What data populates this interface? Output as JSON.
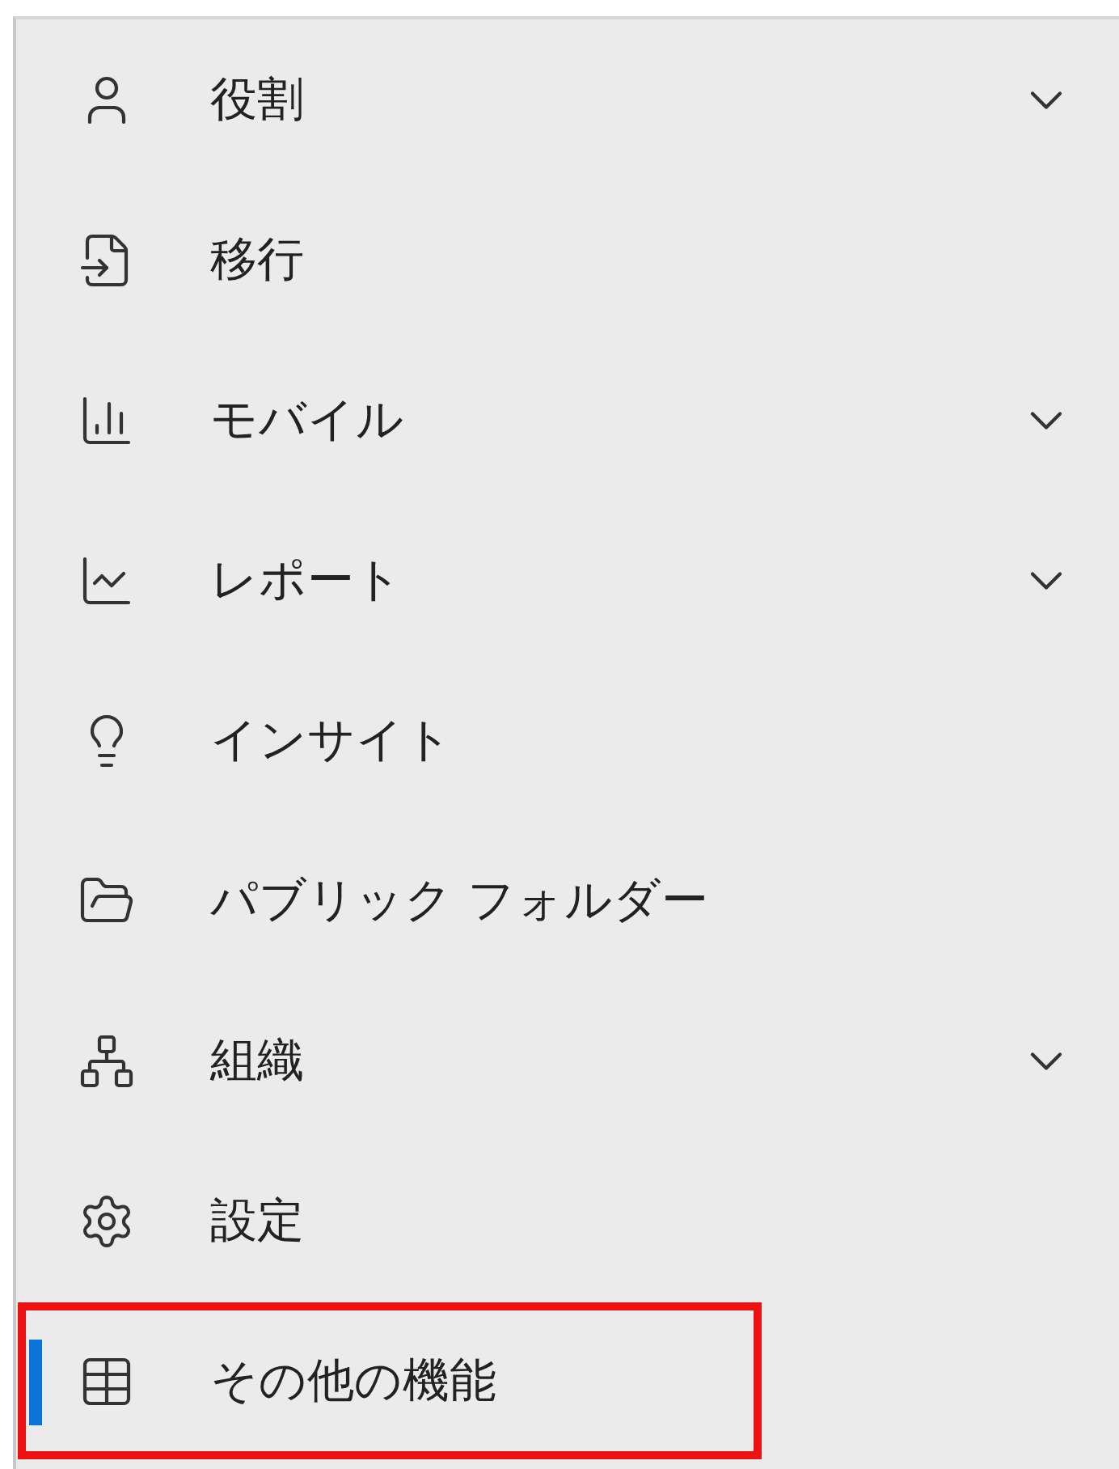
{
  "nav_items": [
    {
      "label": "役割",
      "expandable": true,
      "selected": false,
      "highlighted": false
    },
    {
      "label": "移行",
      "expandable": false,
      "selected": false,
      "highlighted": false
    },
    {
      "label": "モバイル",
      "expandable": true,
      "selected": false,
      "highlighted": false
    },
    {
      "label": "レポート",
      "expandable": true,
      "selected": false,
      "highlighted": false
    },
    {
      "label": "インサイト",
      "expandable": false,
      "selected": false,
      "highlighted": false
    },
    {
      "label": "パブリック フォルダー",
      "expandable": false,
      "selected": false,
      "highlighted": false
    },
    {
      "label": "組織",
      "expandable": true,
      "selected": false,
      "highlighted": false
    },
    {
      "label": "設定",
      "expandable": false,
      "selected": false,
      "highlighted": false
    },
    {
      "label": "その他の機能",
      "expandable": false,
      "selected": true,
      "highlighted": true
    }
  ]
}
